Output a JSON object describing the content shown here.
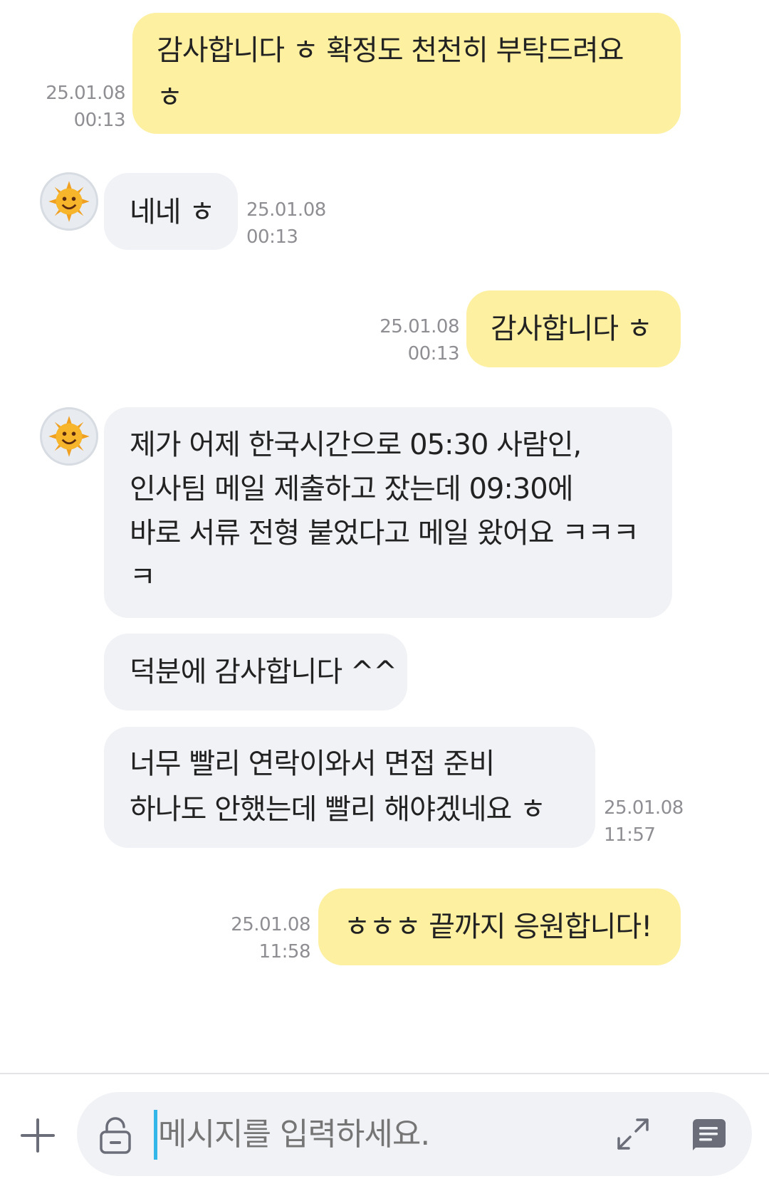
{
  "messages": [
    {
      "sender": "me",
      "lines": [
        "감사합니다 ㅎ 확정도 천천히 부탁드려요",
        "ㅎ"
      ],
      "date": "25.01.08",
      "time": "00:13"
    },
    {
      "sender": "them",
      "lines": [
        "네네 ㅎ"
      ],
      "date": "25.01.08",
      "time": "00:13"
    },
    {
      "sender": "me",
      "lines": [
        "감사합니다 ㅎ"
      ],
      "date": "25.01.08",
      "time": "00:13"
    },
    {
      "sender": "them",
      "lines": [
        "제가 어제 한국시간으로 05:30 사람인,",
        "인사팀 메일 제출하고 잤는데 09:30에",
        "바로 서류 전형 붙었다고 메일 왔어요 ㅋㅋㅋ",
        "ㅋ"
      ]
    },
    {
      "sender": "them",
      "lines": [
        "덕분에 감사합니다 ^^"
      ]
    },
    {
      "sender": "them",
      "lines": [
        "너무 빨리 연락이와서 면접 준비",
        "하나도 안했는데 빨리 해야겠네요 ㅎ"
      ],
      "date": "25.01.08",
      "time": "11:57"
    },
    {
      "sender": "me",
      "lines": [
        "ㅎㅎㅎ 끝까지 응원합니다!"
      ],
      "date": "25.01.08",
      "time": "11:58"
    }
  ],
  "composer": {
    "placeholder": "메시지를 입력하세요."
  },
  "icons": {
    "plus": "plus-icon",
    "lock": "lock-icon",
    "expand": "expand-icon",
    "chat": "chat-icon",
    "avatar": "sun-avatar"
  },
  "colors": {
    "my_bubble": "#fdf0a1",
    "their_bubble": "#f1f2f6",
    "timestamp": "#8e8e93",
    "caret": "#35b6e8"
  }
}
